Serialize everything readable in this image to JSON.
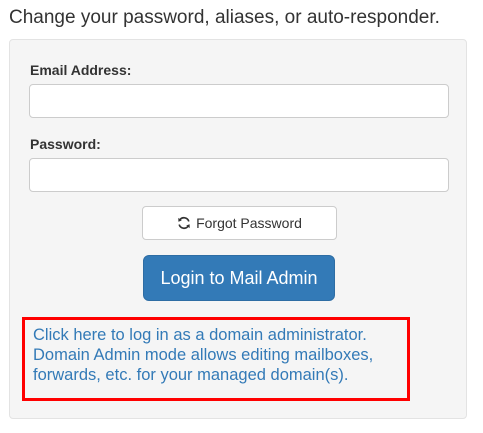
{
  "intro_text": "Change your password, aliases, or auto-responder.",
  "form": {
    "email_label": "Email Address:",
    "email_value": "",
    "password_label": "Password:",
    "password_value": ""
  },
  "buttons": {
    "forgot_label": "Forgot Password",
    "forgot_icon": "refresh-icon",
    "login_label": "Login to Mail Admin"
  },
  "domain_admin": {
    "line1": "Click here to log in as a domain administrator.",
    "line2": "Domain Admin mode allows editing mailboxes,",
    "line3": "forwards, etc. for your managed domain(s)."
  },
  "colors": {
    "primary": "#337ab7",
    "highlight_border": "#ff0000",
    "panel_bg": "#f5f5f5"
  }
}
